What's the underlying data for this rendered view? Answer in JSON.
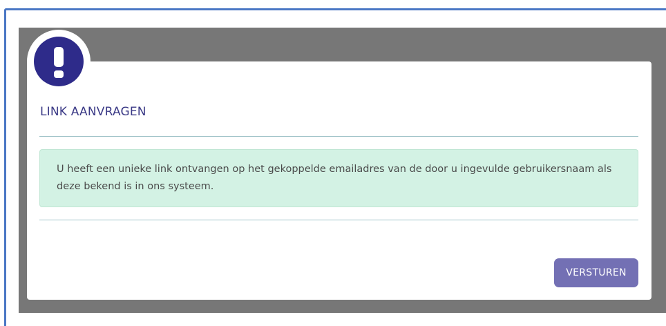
{
  "dialog": {
    "title": "LINK AANVRAGEN",
    "message": "U heeft een unieke link ontvangen op het gekoppelde emailadres van de door u ingevulde gebruikersnaam als deze bekend is in ons systeem.",
    "submit_label": "VERSTUREN"
  },
  "icons": {
    "alert": "exclamation-icon"
  },
  "colors": {
    "frame_border": "#4a77c4",
    "overlay": "#777777",
    "badge": "#2e2b8a",
    "title": "#3b3a86",
    "alert_background": "#d3f2e4",
    "divider": "#9fc3c8",
    "button": "#7370b4"
  }
}
